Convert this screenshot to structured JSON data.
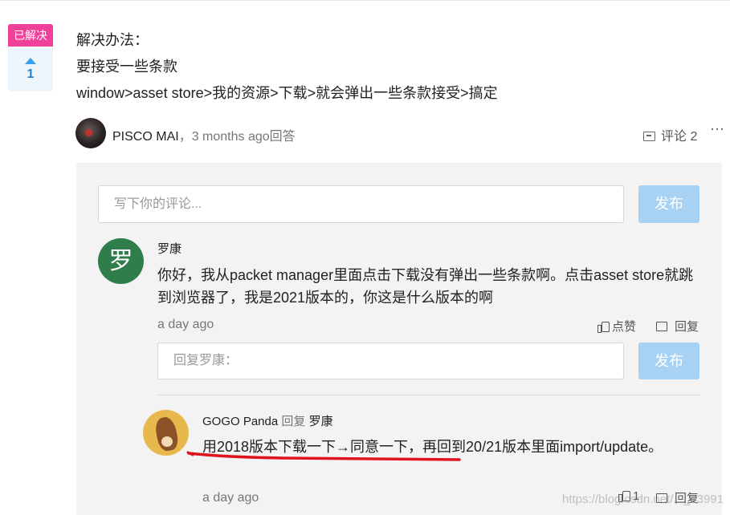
{
  "question": {
    "status_badge": "已解决",
    "vote_count": "1"
  },
  "answer": {
    "lines": [
      "解决办法：",
      "要接受一些条款",
      "window>asset store>我的资源>下载>就会弹出一些条款接受>搞定"
    ],
    "author": "PISCO MAI",
    "separator": "，",
    "time_suffix": "3 months ago回答",
    "comments_label": "评论 2",
    "more_label": "···"
  },
  "comment_box": {
    "placeholder": "写下你的评论...",
    "submit_label": "发布"
  },
  "comments": [
    {
      "avatar_char": "罗",
      "name": "罗康",
      "text": "你好，我从packet manager里面点击下载没有弹出一些条款啊。点击asset store就跳到浏览器了，我是2021版本的，你这是什么版本的啊",
      "time": "a day ago",
      "like_label": "点赞",
      "reply_label": "回复",
      "reply_box": {
        "placeholder": "回复罗康：",
        "submit_label": "发布"
      }
    },
    {
      "name": "GOGO Panda",
      "reply_word": "回复",
      "reply_to": "罗康",
      "text": "用2018版本下载一下→同意一下，再回到20/21版本里面import/update。",
      "time": "a day ago",
      "like_count": "1",
      "reply_label": "回复"
    }
  ],
  "watermark": "https://blog.csdn.net/..._43991",
  "colors": {
    "badge": "#f0419a",
    "vote_bg": "#eef5fb",
    "vote": "#1f82d1",
    "button": "#a8d2f4",
    "panel": "#f3f3f3",
    "annotation": "#e0141e"
  }
}
